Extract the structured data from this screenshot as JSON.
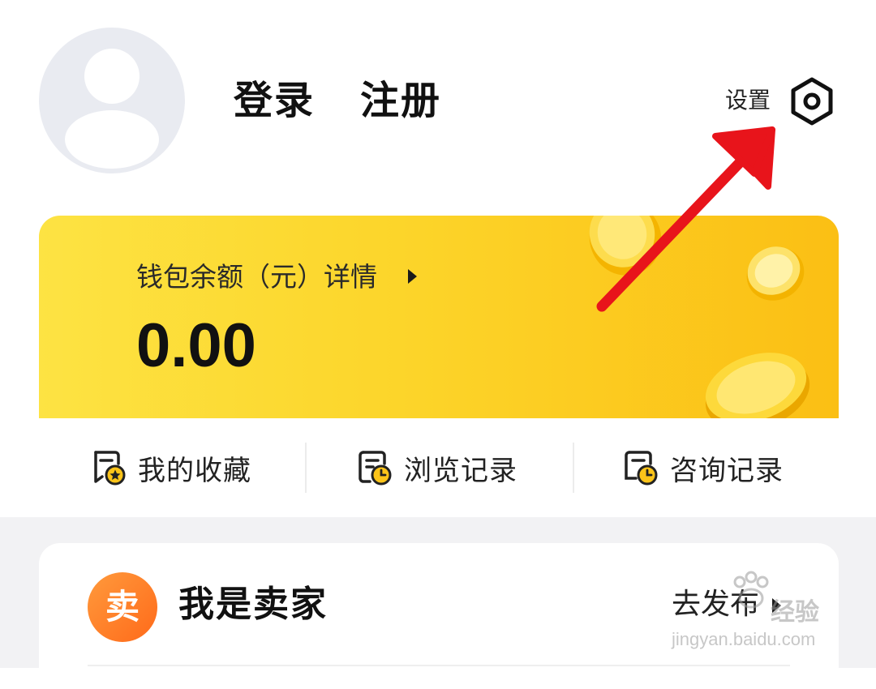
{
  "header": {
    "login_label": "登录",
    "register_label": "注册",
    "settings_label": "设置",
    "settings_icon": "hexagon-gear-icon",
    "avatar_icon": "default-user-avatar"
  },
  "wallet": {
    "label": "钱包余额（元）详情",
    "amount": "0.00",
    "colors": {
      "card_start": "#fde343",
      "card_end": "#fbbf14"
    }
  },
  "quick_actions": [
    {
      "label": "我的收藏",
      "icon": "favorites-doc-star-icon"
    },
    {
      "label": "浏览记录",
      "icon": "history-doc-clock-icon"
    },
    {
      "label": "咨询记录",
      "icon": "consult-doc-clock-icon"
    }
  ],
  "seller": {
    "badge_char": "卖",
    "title": "我是卖家",
    "action_label": "去发布"
  },
  "watermark": {
    "brand": "经验",
    "domain": "jingyan.baidu.com"
  },
  "annotation": {
    "arrow_color": "#e8141b",
    "points_to": "settings"
  }
}
